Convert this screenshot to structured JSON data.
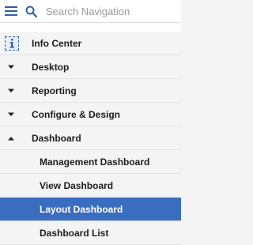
{
  "search": {
    "placeholder": "Search Navigation",
    "value": ""
  },
  "items": [
    {
      "label": "Info Center",
      "icon": "info-icon"
    },
    {
      "label": "Desktop",
      "icon": "caret-down-icon"
    },
    {
      "label": "Reporting",
      "icon": "caret-down-icon"
    },
    {
      "label": "Configure & Design",
      "icon": "caret-down-icon"
    },
    {
      "label": "Dashboard",
      "icon": "caret-up-icon"
    }
  ],
  "dashboard_children": [
    {
      "label": "Management Dashboard"
    },
    {
      "label": "View Dashboard"
    },
    {
      "label": "Layout Dashboard",
      "selected": true
    },
    {
      "label": "Dashboard List"
    }
  ],
  "colors": {
    "accent": "#3a6cbf",
    "icon_blue": "#2f5fa8",
    "background": "#f4f4f4"
  }
}
